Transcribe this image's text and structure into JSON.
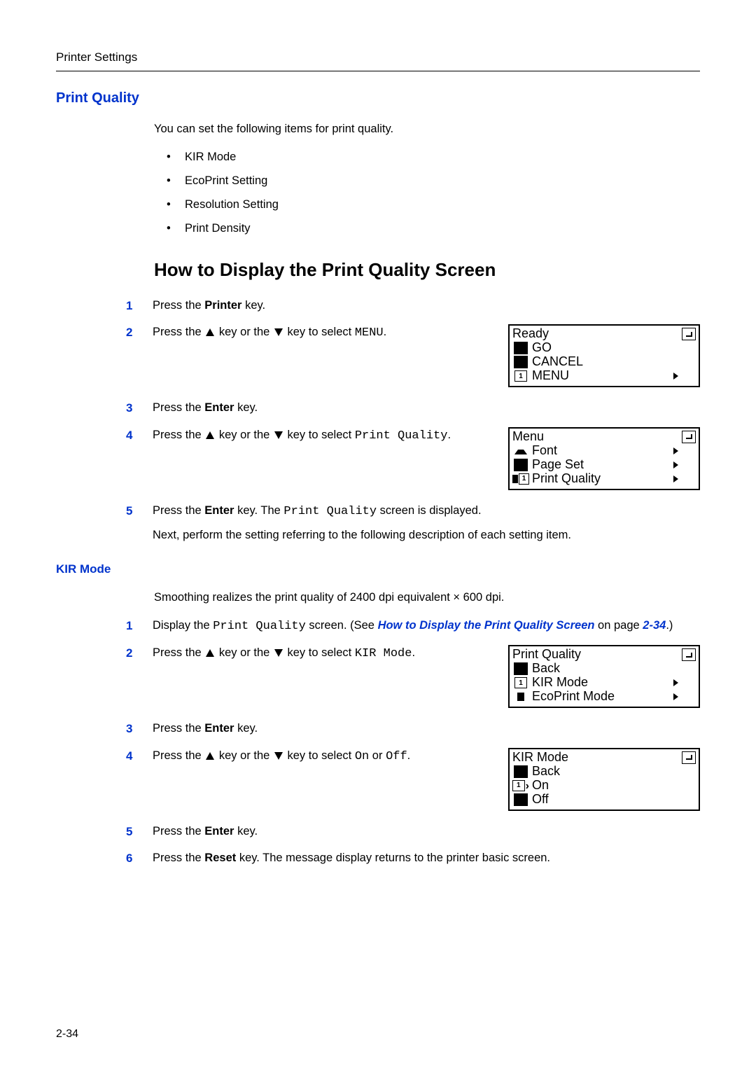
{
  "header": "Printer Settings",
  "section_title": "Print Quality",
  "intro": "You can set the following items for print quality.",
  "bullets": [
    "KIR Mode",
    "EcoPrint Setting",
    "Resolution Setting",
    "Print Density"
  ],
  "howto_title": "How to Display the Print Quality Screen",
  "steps_a": {
    "s1": {
      "num": "1",
      "pre": "Press the ",
      "bold": "Printer",
      "post": " key."
    },
    "s2": {
      "num": "2",
      "pre": "Press the ",
      "mid": " key or the ",
      "post": " key to select ",
      "mono": "MENU",
      "post2": "."
    },
    "s3": {
      "num": "3",
      "pre": "Press the ",
      "bold": "Enter",
      "post": " key."
    },
    "s4": {
      "num": "4",
      "pre": "Press the ",
      "mid": " key or the ",
      "post": " key to select ",
      "mono": "Print Quality",
      "post2": "."
    },
    "s5": {
      "num": "5",
      "pre": "Press the ",
      "bold": "Enter",
      "post": " key. The ",
      "mono": "Print Quality",
      "post2": " screen is displayed.",
      "line2": "Next, perform the setting referring to the following description of each setting item."
    }
  },
  "panel1": {
    "title": "Ready",
    "rows": [
      {
        "left": "black",
        "label": "GO"
      },
      {
        "left": "black",
        "label": "CANCEL"
      },
      {
        "left": "num",
        "label": "MENU",
        "right": "arrow"
      }
    ]
  },
  "panel2": {
    "title": "Menu",
    "rows": [
      {
        "left": "up",
        "label": "Font",
        "right": "arrow"
      },
      {
        "left": "black",
        "label": "Page Set",
        "right": "arrow"
      },
      {
        "left": "numdn",
        "label": "Print Quality",
        "right": "arrow"
      }
    ]
  },
  "subsection": "KIR Mode",
  "kir_intro": "Smoothing realizes the print quality of 2400 dpi equivalent × 600 dpi.",
  "steps_b": {
    "s1": {
      "num": "1",
      "pre": "Display the ",
      "mono": "Print Quality",
      "mid": " screen. (See ",
      "link": "How to Display the Print Quality Screen",
      "post": " on page ",
      "link2": "2-34",
      "post2": ".)"
    },
    "s2": {
      "num": "2",
      "pre": "Press the ",
      "mid": " key or the ",
      "post": " key to select ",
      "mono": "KIR Mode",
      "post2": "."
    },
    "s3": {
      "num": "3",
      "pre": "Press the ",
      "bold": "Enter",
      "post": " key."
    },
    "s4": {
      "num": "4",
      "pre": "Press the ",
      "mid": " key or the ",
      "post": " key to select ",
      "mono1": "On",
      "or": " or ",
      "mono2": "Off",
      "post2": "."
    },
    "s5": {
      "num": "5",
      "pre": "Press the ",
      "bold": "Enter",
      "post": " key."
    },
    "s6": {
      "num": "6",
      "pre": "Press the ",
      "bold": "Reset",
      "post": " key. The message display returns to the printer basic screen."
    }
  },
  "panel3": {
    "title": "Print Quality",
    "rows": [
      {
        "left": "black",
        "label": "Back"
      },
      {
        "left": "num",
        "label": "KIR Mode",
        "right": "arrow"
      },
      {
        "left": "dn",
        "label": "EcoPrint Mode",
        "right": "arrow"
      }
    ]
  },
  "panel4": {
    "title": "KIR Mode",
    "rows": [
      {
        "left": "black",
        "label": "Back"
      },
      {
        "left": "numptr",
        "label": "On"
      },
      {
        "left": "black",
        "label": "Off"
      }
    ]
  },
  "page_number": "2-34"
}
